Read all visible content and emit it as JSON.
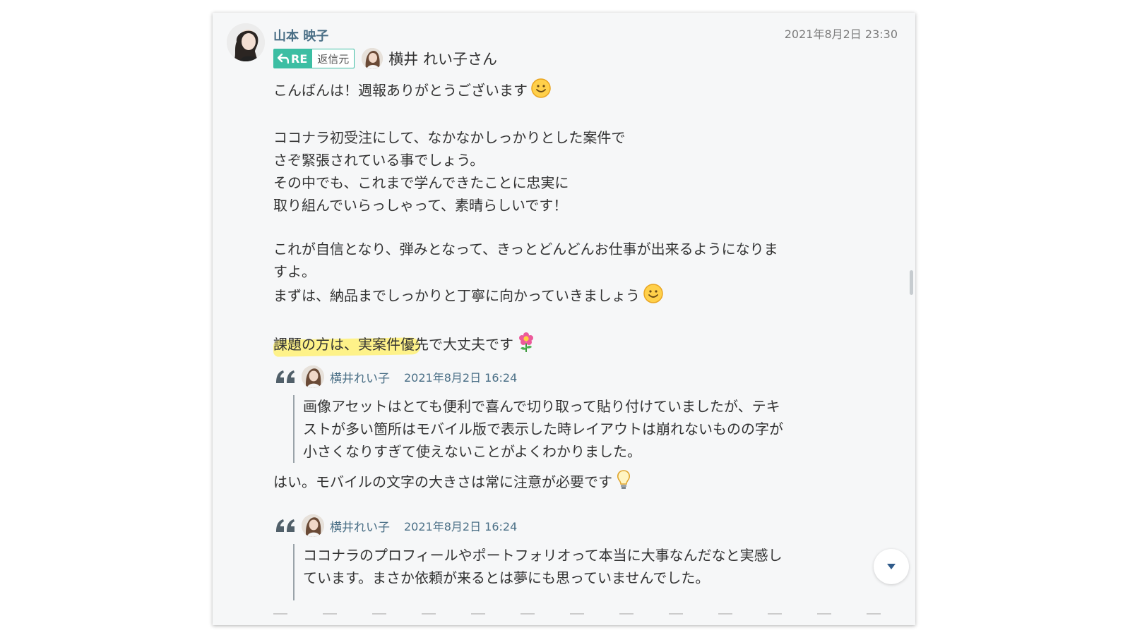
{
  "post": {
    "author": "山本 映子",
    "timestamp": "2021年8月2日 23:30",
    "reply_badge": "RE",
    "reply_source_label": "返信元",
    "reply_to_name": "横井 れい子さん",
    "paragraphs": [
      [
        "こんばんは！週報ありがとうございます"
      ],
      [
        "ココナラ初受注にして、なかなかしっかりとした案件で",
        "さぞ緊張されている事でしょう。",
        "その中でも、これまで学んできたことに忠実に",
        "取り組んでいらっしゃって、素晴らしいです！"
      ],
      [
        "これが自信となり、弾みとなって、きっとどんどんお仕事が出来るようになりま",
        "すよ。",
        "まずは、納品までしっかりと丁寧に向かっていきましょう"
      ],
      [
        "課題の方は、実案件優先で大丈夫です"
      ]
    ]
  },
  "quotes": [
    {
      "name": "横井れい子",
      "date": "2021年8月2日 16:24",
      "lines": [
        "画像アセットはとても便利で喜んで切り取って貼り付けていましたが、テキ",
        "ストが多い箇所はモバイル版で表示した時レイアウトは崩れないものの字が",
        "小さくなりすぎて使えないことがよくわかりました。"
      ],
      "reply": "はい。モバイルの文字の大きさは常に注意が必要です"
    },
    {
      "name": "横井れい子",
      "date": "2021年8月2日 16:24",
      "lines": [
        "ココナラのプロフィールやポートフォリオって本当に大事なんだなと実感し",
        "ています。まさか依頼が来るとは夢にも思っていませんでした。"
      ]
    }
  ],
  "colors": {
    "accent": "#3cbea3",
    "name_blue": "#4a6f86",
    "highlight": "#fff176",
    "card_bg": "#f6f7f8"
  },
  "icons": [
    "reply-arrow-icon",
    "smile-emoji-icon",
    "flower-emoji-icon",
    "lightbulb-emoji-icon",
    "quote-mark-icon",
    "chevron-down-icon"
  ]
}
